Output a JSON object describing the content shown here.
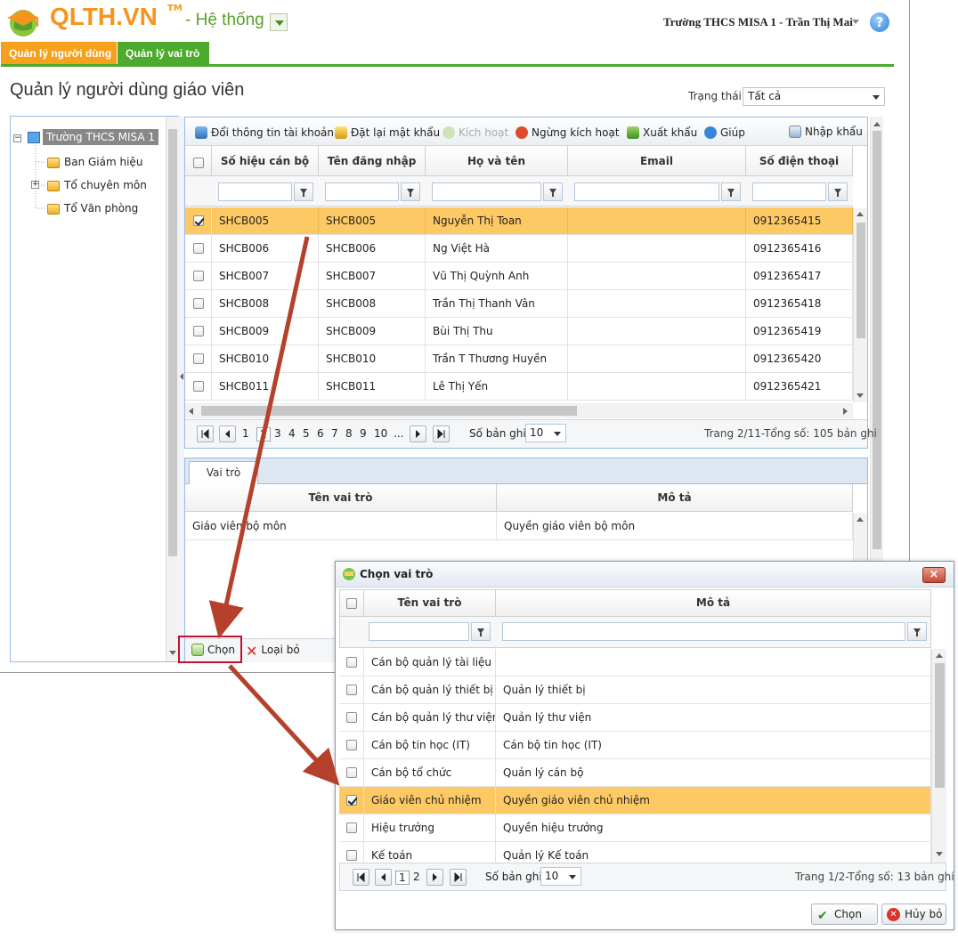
{
  "header": {
    "logo_text": "QLTH.VN",
    "logo_tm": "TM",
    "system_label": "- Hệ thống",
    "user_label": "Trường THCS MISA 1 - Trần Thị Mai",
    "help_glyph": "?"
  },
  "tabs": [
    {
      "label": "Quản lý người dùng",
      "color": "#f5a11c"
    },
    {
      "label": "Quản lý vai trò",
      "color": "#4caa2c"
    }
  ],
  "page": {
    "title": "Quản lý người dùng giáo viên",
    "status_label": "Trạng thái",
    "status_value": "Tất cả"
  },
  "tree": {
    "root": "Trường THCS MISA 1",
    "children": [
      "Ban Giám hiệu",
      "Tổ chuyên môn",
      "Tổ Văn phòng"
    ],
    "expander_glyph": "+",
    "collapse_glyph": "−"
  },
  "toolbar": {
    "change_info": "Đổi thông tin tài khoản",
    "reset_password": "Đặt lại mật khẩu",
    "activate": "Kích hoạt",
    "deactivate": "Ngừng kích hoạt",
    "export": "Xuất khẩu",
    "help": "Giúp",
    "import": "Nhập khẩu"
  },
  "users_grid": {
    "columns": [
      "Số hiệu cán bộ",
      "Tên đăng nhập",
      "Họ và tên",
      "Email",
      "Số điện thoại"
    ],
    "rows": [
      {
        "code": "SHCB005",
        "login": "SHCB005",
        "name": "Nguyễn Thị Toan",
        "email": "",
        "phone": "0912365415",
        "selected": true
      },
      {
        "code": "SHCB006",
        "login": "SHCB006",
        "name": "Ng Việt Hà",
        "email": "",
        "phone": "0912365416",
        "selected": false
      },
      {
        "code": "SHCB007",
        "login": "SHCB007",
        "name": "Vũ Thị Quỳnh Anh",
        "email": "",
        "phone": "0912365417",
        "selected": false
      },
      {
        "code": "SHCB008",
        "login": "SHCB008",
        "name": "Trần Thị Thanh Vân",
        "email": "",
        "phone": "0912365418",
        "selected": false
      },
      {
        "code": "SHCB009",
        "login": "SHCB009",
        "name": "Bùi Thị Thu",
        "email": "",
        "phone": "0912365419",
        "selected": false
      },
      {
        "code": "SHCB010",
        "login": "SHCB010",
        "name": "Trần T Thương Huyền",
        "email": "",
        "phone": "0912365420",
        "selected": false
      },
      {
        "code": "SHCB011",
        "login": "SHCB011",
        "name": "Lê Thị Yến",
        "email": "",
        "phone": "0912365421",
        "selected": false
      }
    ],
    "pager": {
      "pages": [
        "1",
        "2",
        "3",
        "4",
        "5",
        "6",
        "7",
        "8",
        "9",
        "10",
        "..."
      ],
      "current_page": 2,
      "page_size_label": "Số bản ghi:",
      "page_size": "10",
      "summary": "Trang 2/11-Tổng số: 105 bản ghi"
    }
  },
  "roles_panel": {
    "tab": "Vai trò",
    "columns": [
      "Tên vai trò",
      "Mô tả"
    ],
    "rows": [
      {
        "name": "Giáo viên bộ môn",
        "desc": "Quyền giáo viên bộ môn"
      }
    ],
    "choose_button": "Chọn",
    "remove_button": "Loại bỏ"
  },
  "dialog": {
    "title": "Chọn vai trò",
    "close_glyph": "×",
    "columns": [
      "Tên vai trò",
      "Mô tả"
    ],
    "rows": [
      {
        "name": "Cán bộ quản lý tài liệu",
        "desc": "",
        "selected": false
      },
      {
        "name": "Cán bộ quản lý thiết bị",
        "desc": "Quản lý thiết bị",
        "selected": false
      },
      {
        "name": "Cán bộ quản lý thư viện",
        "desc": "Quản lý thư viện",
        "selected": false
      },
      {
        "name": "Cán bộ tin học (IT)",
        "desc": "Cán bộ tin học (IT)",
        "selected": false
      },
      {
        "name": "Cán bộ tổ chức",
        "desc": "Quản lý cán bộ",
        "selected": false
      },
      {
        "name": "Giáo viên chủ nhiệm",
        "desc": "Quyền giáo viên chủ nhiệm",
        "selected": true
      },
      {
        "name": "Hiệu trưởng",
        "desc": "Quyền hiệu trưởng",
        "selected": false
      },
      {
        "name": "Kế toán",
        "desc": "Quản lý Kế toán",
        "selected": false
      }
    ],
    "pager": {
      "pages": [
        "1",
        "2"
      ],
      "current_page": 1,
      "page_size_label": "Số bản ghi:",
      "page_size": "10",
      "summary": "Trang 1/2-Tổng số: 13 bản ghi"
    },
    "ok_button": "Chọn",
    "cancel_button": "Hủy bỏ"
  },
  "colors": {
    "brand_orange": "#f7941d",
    "brand_green": "#4caa2c",
    "selected_row": "#fdc965",
    "annotation_red": "#b5402c"
  }
}
